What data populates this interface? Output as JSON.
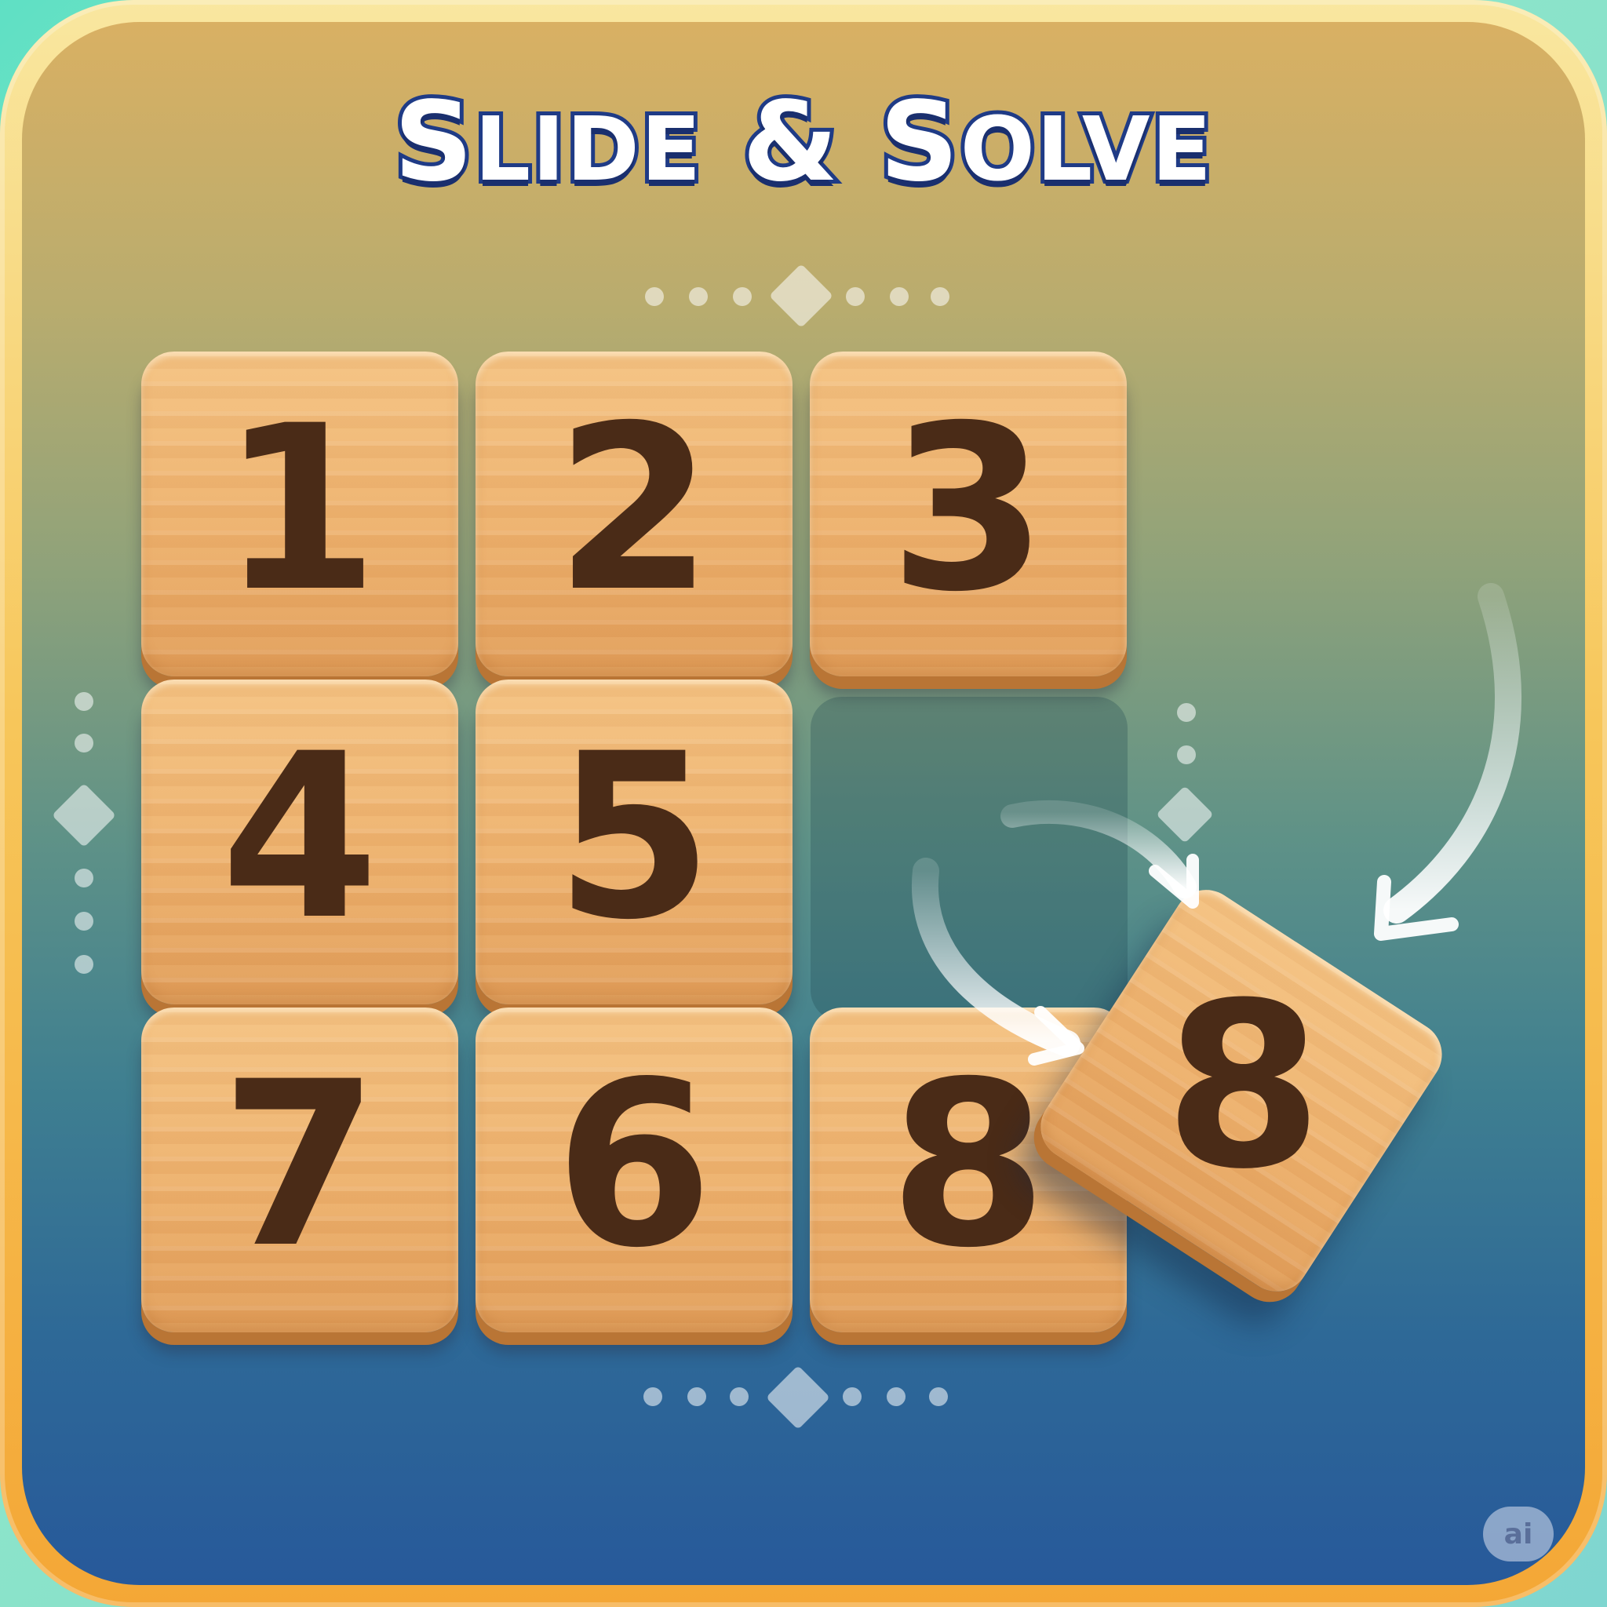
{
  "title": {
    "text": "Slide & Solve",
    "parts": [
      "S",
      "LIDE",
      " & ",
      "S",
      "OLVE"
    ]
  },
  "board": {
    "rows": 3,
    "cols": 3,
    "tiles": [
      {
        "label": "1",
        "row": 0,
        "col": 0
      },
      {
        "label": "2",
        "row": 0,
        "col": 1
      },
      {
        "label": "3",
        "row": 0,
        "col": 2
      },
      {
        "label": "4",
        "row": 1,
        "col": 0
      },
      {
        "label": "5",
        "row": 1,
        "col": 1
      },
      {
        "label": "7",
        "row": 2,
        "col": 0
      },
      {
        "label": "6",
        "row": 2,
        "col": 1
      },
      {
        "label": "8",
        "row": 2,
        "col": 2
      }
    ],
    "empty_cell": {
      "row": 1,
      "col": 2
    },
    "moving_tile": {
      "label": "8"
    }
  },
  "watermark": {
    "text": "ai"
  },
  "colors": {
    "tile_text": "#4a2b17",
    "title_fill": "#ffffff",
    "title_outline": "#1f3b86",
    "frame": "#f7c65a"
  },
  "icons": {
    "decor_diamond": "diamond-icon",
    "decor_dot": "dot-icon",
    "move_arrow": "curved-arrow-icon"
  }
}
